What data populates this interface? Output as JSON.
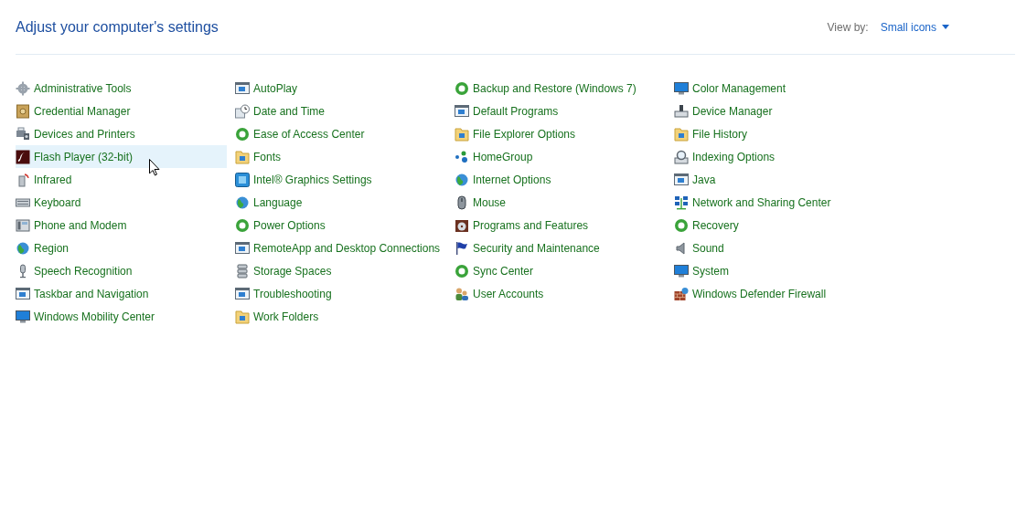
{
  "header": {
    "title": "Adjust your computer's settings",
    "view_by_label": "View by:",
    "view_by_value": "Small icons"
  },
  "columns": [
    [
      {
        "label": "Administrative Tools",
        "hovered": false
      },
      {
        "label": "Credential Manager",
        "hovered": false
      },
      {
        "label": "Devices and Printers",
        "hovered": false
      },
      {
        "label": "Flash Player (32-bit)",
        "hovered": true
      },
      {
        "label": "Infrared",
        "hovered": false
      },
      {
        "label": "Keyboard",
        "hovered": false
      },
      {
        "label": "Phone and Modem",
        "hovered": false
      },
      {
        "label": "Region",
        "hovered": false
      },
      {
        "label": "Speech Recognition",
        "hovered": false
      },
      {
        "label": "Taskbar and Navigation",
        "hovered": false
      },
      {
        "label": "Windows Mobility Center",
        "hovered": false
      }
    ],
    [
      {
        "label": "AutoPlay",
        "hovered": false
      },
      {
        "label": "Date and Time",
        "hovered": false
      },
      {
        "label": "Ease of Access Center",
        "hovered": false
      },
      {
        "label": "Fonts",
        "hovered": false
      },
      {
        "label": "Intel® Graphics Settings",
        "hovered": false
      },
      {
        "label": "Language",
        "hovered": false
      },
      {
        "label": "Power Options",
        "hovered": false
      },
      {
        "label": "RemoteApp and Desktop Connections",
        "hovered": false
      },
      {
        "label": "Storage Spaces",
        "hovered": false
      },
      {
        "label": "Troubleshooting",
        "hovered": false
      },
      {
        "label": "Work Folders",
        "hovered": false
      }
    ],
    [
      {
        "label": "Backup and Restore (Windows 7)",
        "hovered": false
      },
      {
        "label": "Default Programs",
        "hovered": false
      },
      {
        "label": "File Explorer Options",
        "hovered": false
      },
      {
        "label": "HomeGroup",
        "hovered": false
      },
      {
        "label": "Internet Options",
        "hovered": false
      },
      {
        "label": "Mouse",
        "hovered": false
      },
      {
        "label": "Programs and Features",
        "hovered": false
      },
      {
        "label": "Security and Maintenance",
        "hovered": false
      },
      {
        "label": "Sync Center",
        "hovered": false
      },
      {
        "label": "User Accounts",
        "hovered": false
      }
    ],
    [
      {
        "label": "Color Management",
        "hovered": false
      },
      {
        "label": "Device Manager",
        "hovered": false
      },
      {
        "label": "File History",
        "hovered": false
      },
      {
        "label": "Indexing Options",
        "hovered": false
      },
      {
        "label": "Java",
        "hovered": false
      },
      {
        "label": "Network and Sharing Center",
        "hovered": false
      },
      {
        "label": "Recovery",
        "hovered": false
      },
      {
        "label": "Sound",
        "hovered": false
      },
      {
        "label": "System",
        "hovered": false
      },
      {
        "label": "Windows Defender Firewall",
        "hovered": false
      }
    ]
  ]
}
